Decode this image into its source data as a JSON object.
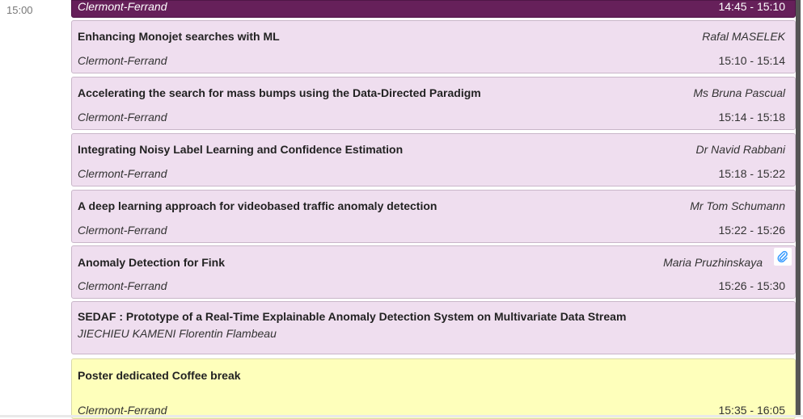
{
  "time_axis": {
    "label": "15:00"
  },
  "entries": [
    {
      "title": "",
      "speaker": "",
      "room": "Clermont-Ferrand",
      "time": "14:45 - 15:10"
    },
    {
      "title": "Enhancing Monojet searches with ML",
      "speaker": "Rafal MASELEK",
      "room": "Clermont-Ferrand",
      "time": "15:10 - 15:14"
    },
    {
      "title": "Accelerating the search for mass bumps using the Data-Directed Paradigm",
      "speaker": "Ms Bruna Pascual",
      "room": "Clermont-Ferrand",
      "time": "15:14 - 15:18"
    },
    {
      "title": "Integrating Noisy Label Learning and Confidence Estimation",
      "speaker": "Dr Navid Rabbani",
      "room": "Clermont-Ferrand",
      "time": "15:18 - 15:22"
    },
    {
      "title": "A deep learning approach for videobased traffic anomaly detection",
      "speaker": "Mr Tom Schumann",
      "room": "Clermont-Ferrand",
      "time": "15:22 - 15:26"
    },
    {
      "title": "Anomaly Detection for Fink",
      "speaker": "Maria Pruzhinskaya",
      "room": "Clermont-Ferrand",
      "time": "15:26 - 15:30",
      "icon": "paperclip-icon"
    },
    {
      "title": "SEDAF : Prototype of a Real-Time Explainable Anomaly Detection System on Multivariate Data Stream",
      "speaker": "JIECHIEU KAMENI Florentin Flambeau"
    },
    {
      "title": "Poster dedicated Coffee break",
      "room": "Clermont-Ferrand",
      "time": "15:35 - 16:05"
    }
  ],
  "colors": {
    "session": "#66205a",
    "contribution": "#efdeef",
    "break": "#feffbb",
    "attachment": "#3399ff"
  }
}
